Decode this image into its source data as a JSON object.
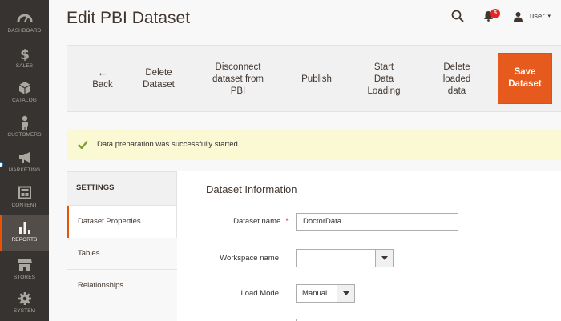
{
  "sidebar": {
    "items": [
      {
        "label": "DASHBOARD",
        "icon": "dashboard-icon"
      },
      {
        "label": "SALES",
        "icon": "dollar-icon"
      },
      {
        "label": "CATALOG",
        "icon": "cube-icon"
      },
      {
        "label": "CUSTOMERS",
        "icon": "person-icon"
      },
      {
        "label": "MARKETING",
        "icon": "megaphone-icon"
      },
      {
        "label": "CONTENT",
        "icon": "layout-icon"
      },
      {
        "label": "REPORTS",
        "icon": "bar-chart-icon"
      },
      {
        "label": "STORES",
        "icon": "store-icon"
      },
      {
        "label": "SYSTEM",
        "icon": "gear-icon"
      }
    ],
    "active": "REPORTS",
    "accent": "#eb5202"
  },
  "header": {
    "title": "Edit PBI Dataset",
    "notifications_count": "5",
    "user_name": "user",
    "caret": "▾"
  },
  "toolbar": {
    "back": {
      "arrow": "←",
      "label": "Back"
    },
    "delete_dataset": [
      "Delete",
      "Dataset"
    ],
    "disconnect": [
      "Disconnect",
      "dataset from",
      "PBI"
    ],
    "publish": [
      "Publish"
    ],
    "start_loading": [
      "Start",
      "Data",
      "Loading"
    ],
    "delete_loaded": [
      "Delete",
      "loaded",
      "data"
    ],
    "save": [
      "Save",
      "Dataset"
    ],
    "save_color": "#e65a1e"
  },
  "message": {
    "text": "Data preparation was successfully started.",
    "check_color": "#79a22e",
    "background": "#fbf8d4"
  },
  "tabs": {
    "heading": "SETTINGS",
    "items": [
      "Dataset Properties",
      "Tables",
      "Relationships"
    ],
    "active": "Dataset Properties"
  },
  "form": {
    "section_title": "Dataset Information",
    "dataset_name": {
      "label": "Dataset name",
      "required_mark": "*",
      "value": "DoctorData"
    },
    "workspace_name": {
      "label": "Workspace name",
      "value": ""
    },
    "load_mode": {
      "label": "Load Mode",
      "value": "Manual"
    }
  }
}
